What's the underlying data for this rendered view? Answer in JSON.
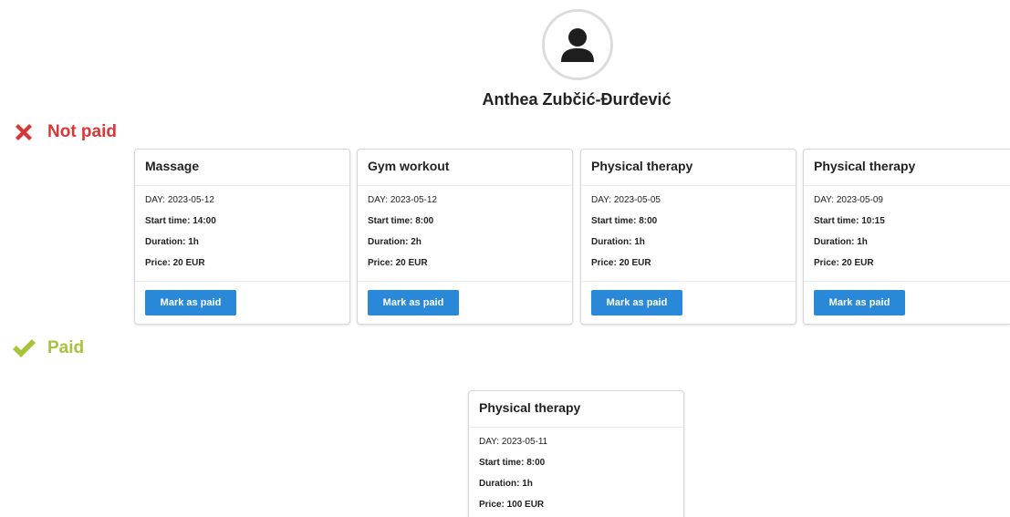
{
  "user": {
    "name": "Anthea Zubčić-Đurđević",
    "avatar_icon": "user-icon"
  },
  "sections": {
    "unpaid": {
      "label": "Not paid",
      "icon": "x-mark-icon",
      "color": "#d93636"
    },
    "paid": {
      "label": "Paid",
      "icon": "check-mark-icon",
      "color": "#a5c43a"
    }
  },
  "colors": {
    "button": "#2a88d8"
  },
  "unpaid_cards": [
    {
      "title": "Massage",
      "day": "DAY: 2023-05-12",
      "start": "Start time: 14:00",
      "duration": "Duration: 1h",
      "price": "Price: 20 EUR",
      "button": "Mark as paid"
    },
    {
      "title": "Gym workout",
      "day": "DAY: 2023-05-12",
      "start": "Start time: 8:00",
      "duration": "Duration: 2h",
      "price": "Price: 20 EUR",
      "button": "Mark as paid"
    },
    {
      "title": "Physical therapy",
      "day": "DAY: 2023-05-05",
      "start": "Start time: 8:00",
      "duration": "Duration: 1h",
      "price": "Price: 20 EUR",
      "button": "Mark as paid"
    },
    {
      "title": "Physical therapy",
      "day": "DAY: 2023-05-09",
      "start": "Start time: 10:15",
      "duration": "Duration: 1h",
      "price": "Price: 20 EUR",
      "button": "Mark as paid"
    }
  ],
  "paid_cards": [
    {
      "title": "Physical therapy",
      "day": "DAY: 2023-05-11",
      "start": "Start time: 8:00",
      "duration": "Duration: 1h",
      "price": "Price: 100 EUR"
    }
  ]
}
